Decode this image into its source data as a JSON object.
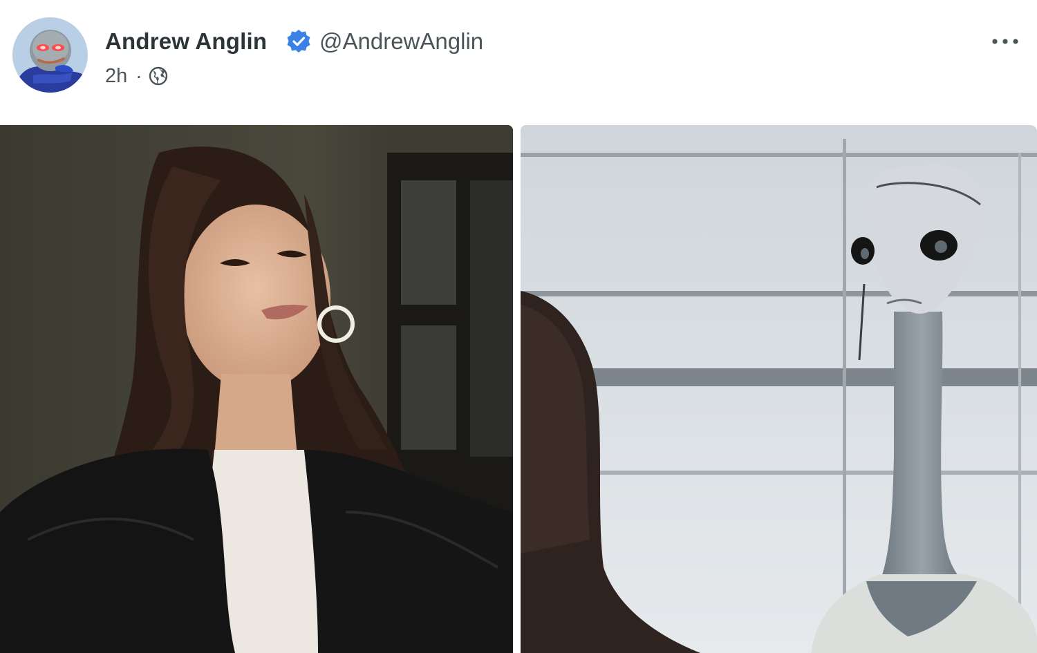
{
  "post": {
    "author_name": "Andrew Anglin",
    "handle": "@AndrewAnglin",
    "time": "2h",
    "separator": "·",
    "verified": true,
    "visibility_icon": "globe-icon",
    "more_icon": "more-options-icon"
  },
  "media": {
    "left_icon": "photo-woman-in-black-jacket",
    "right_icon": "photo-long-necked-alien"
  },
  "colors": {
    "name_text": "#2b3437",
    "secondary_text": "#4a5558",
    "verified_badge": "#3b82e6"
  }
}
